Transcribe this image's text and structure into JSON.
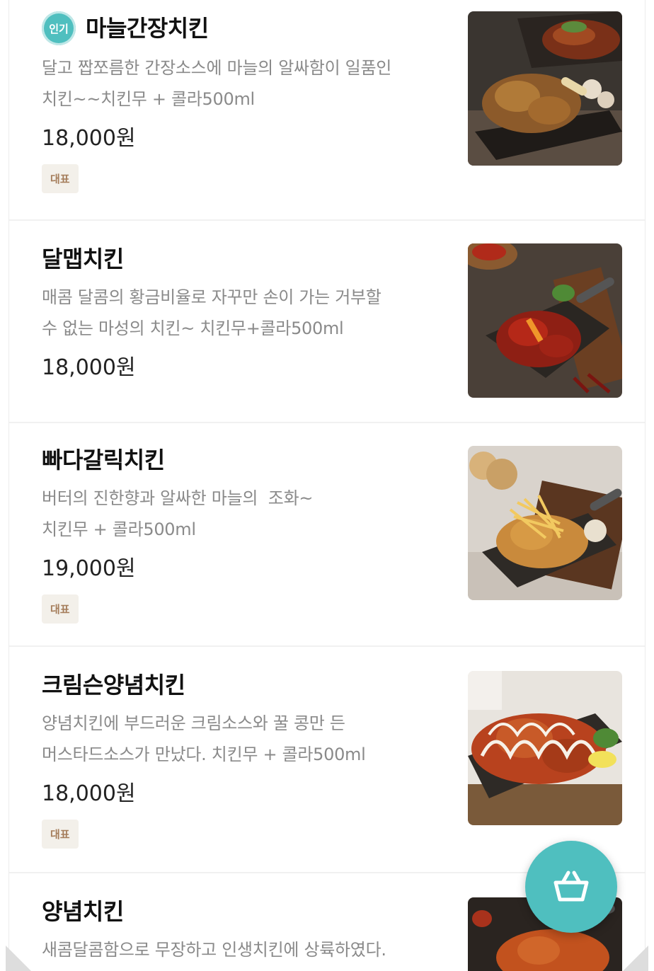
{
  "menu": {
    "items": [
      {
        "badge": "인기",
        "name": "마늘간장치킨",
        "desc_line1": "달고 짭쪼름한 간장소스에 마늘의 알싸함이 일품인",
        "desc_line2": "치킨~~치킨무 + 콜라500ml",
        "price": "18,000원",
        "tag": "대표",
        "image_icon": "garlic-soy-chicken-photo"
      },
      {
        "name": "달맵치킨",
        "desc_line1": "매콤 달콤의 황금비율로 자꾸만 손이 가는 거부할",
        "desc_line2": "수 없는 마성의 치킨~ 치킨무+콜라500ml",
        "price": "18,000원",
        "image_icon": "sweet-spicy-chicken-photo"
      },
      {
        "name": "빠다갈릭치킨",
        "desc_line1": "버터의 진한향과 알싸한 마늘의  조화~",
        "desc_line2": "치킨무 + 콜라500ml",
        "price": "19,000원",
        "tag": "대표",
        "image_icon": "butter-garlic-chicken-photo"
      },
      {
        "name": "크림슨양념치킨",
        "desc_line1": "양념치킨에 부드러운 크림소스와 꿀 콩만 든",
        "desc_line2": "머스타드소스가 만났다. 치킨무 + 콜라500ml",
        "price": "18,000원",
        "tag": "대표",
        "image_icon": "crimson-seasoned-chicken-photo"
      },
      {
        "name": "양념치킨",
        "desc_line1": "새콤달콤함으로 무장하고 인생치킨에 상륙하였다.",
        "image_icon": "seasoned-chicken-photo"
      }
    ]
  },
  "cart_button": {
    "icon": "shopping-basket-icon"
  },
  "colors": {
    "accent": "#4fbfbf",
    "tag_bg": "#f3f0ea",
    "tag_text": "#a57d5b",
    "desc_text": "#8a8a8a"
  }
}
